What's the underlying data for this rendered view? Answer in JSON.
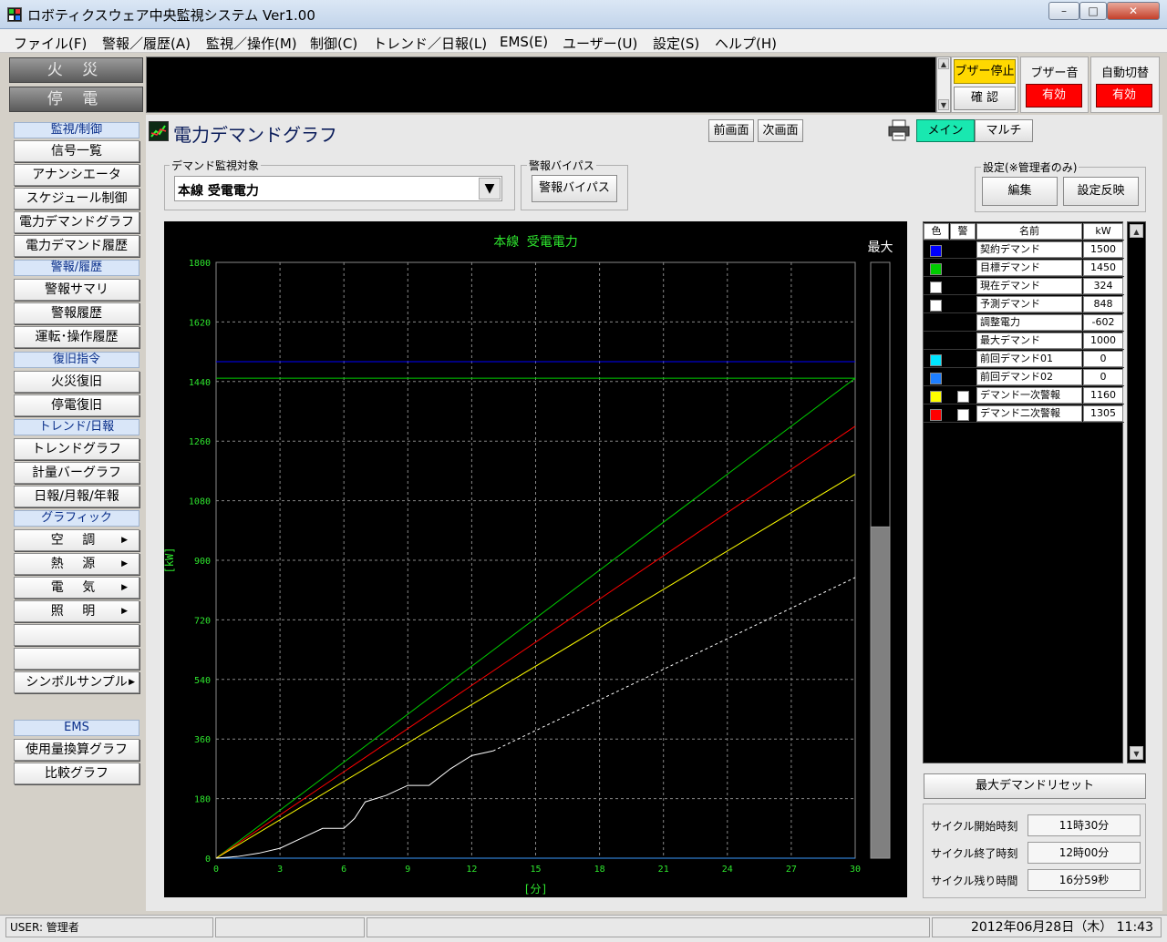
{
  "window": {
    "title": "ロボティクスウェア中央監視システム Ver1.00"
  },
  "menu": [
    "ファイル(F)",
    "警報／履歴(A)",
    "監視／操作(M)",
    "制御(C)",
    "トレンド／日報(L)",
    "EMS(E)",
    "ユーザー(U)",
    "設定(S)",
    "ヘルプ(H)"
  ],
  "alarms": {
    "fire": "火 災",
    "power": "停 電"
  },
  "buzzer": {
    "stop": "ブザー停止",
    "confirm": "確 認",
    "sound_label": "ブザー音",
    "sound_value": "有効",
    "auto_label": "自動切替",
    "auto_value": "有効"
  },
  "sidebar": {
    "monitor_head": "監視/制御",
    "monitor": [
      "信号一覧",
      "アナンシエータ",
      "スケジュール制御",
      "電力デマンドグラフ",
      "電力デマンド履歴"
    ],
    "alarm_head": "警報/履歴",
    "alarm": [
      "警報サマリ",
      "警報履歴",
      "運転･操作履歴"
    ],
    "restore_head": "復旧指令",
    "restore": [
      "火災復旧",
      "停電復旧"
    ],
    "trend_head": "トレンド/日報",
    "trend": [
      "トレンドグラフ",
      "計量バーグラフ",
      "日報/月報/年報"
    ],
    "graphic_head": "グラフィック",
    "graphic": [
      "空 調",
      "熱 源",
      "電 気",
      "照 明",
      "",
      "",
      "シンボルサンプル"
    ],
    "ems_head": "EMS",
    "ems": [
      "使用量換算グラフ",
      "比較グラフ"
    ]
  },
  "page": {
    "title": "電力デマンドグラフ",
    "prev": "前画面",
    "next": "次画面",
    "view_main": "メイン",
    "view_multi": "マルチ",
    "target_legend": "デマンド監視対象",
    "target_value": "本線 受電電力",
    "bypass_legend": "警報バイパス",
    "bypass_btn": "警報バイパス",
    "settings_legend": "設定(※管理者のみ)",
    "edit_btn": "編集",
    "apply_btn": "設定反映"
  },
  "chart_data": {
    "type": "line",
    "title": "本線 受電電力",
    "xlabel": "[分]",
    "ylabel": "[kW]",
    "xlim": [
      0,
      30
    ],
    "ylim": [
      0,
      1800
    ],
    "xticks": [
      0,
      3,
      6,
      9,
      12,
      15,
      18,
      21,
      24,
      27,
      30
    ],
    "yticks": [
      0,
      180,
      360,
      540,
      720,
      900,
      1080,
      1260,
      1440,
      1620,
      1800
    ],
    "grid": true,
    "series": [
      {
        "name": "契約デマンド",
        "color": "#0000ff",
        "style": "solid",
        "x": [
          0,
          30
        ],
        "y": [
          1500,
          1500
        ]
      },
      {
        "name": "目標デマンド",
        "color": "#00cc00",
        "style": "solid",
        "x": [
          0,
          30
        ],
        "y": [
          1450,
          1450
        ]
      },
      {
        "name": "目標デマンド",
        "color": "#00cc00",
        "style": "solid",
        "x": [
          0,
          30
        ],
        "y": [
          0,
          1450
        ]
      },
      {
        "name": "デマンド二次警報",
        "color": "#ff0000",
        "style": "solid",
        "x": [
          0,
          30
        ],
        "y": [
          0,
          1305
        ]
      },
      {
        "name": "デマンド一次警報",
        "color": "#ffff00",
        "style": "solid",
        "x": [
          0,
          30
        ],
        "y": [
          0,
          1160
        ]
      },
      {
        "name": "前回デマンド01",
        "color": "#3a9aff",
        "style": "solid",
        "x": [
          0,
          30
        ],
        "y": [
          0,
          0
        ]
      },
      {
        "name": "現在デマンド",
        "color": "#ffffff",
        "style": "solid",
        "x": [
          0,
          1,
          2,
          3,
          4,
          5,
          6,
          6.5,
          7,
          8,
          9,
          10,
          11,
          12,
          13
        ],
        "y": [
          0,
          5,
          15,
          30,
          60,
          90,
          90,
          120,
          170,
          190,
          220,
          220,
          270,
          310,
          324
        ]
      },
      {
        "name": "予測デマンド",
        "color": "#ffffff",
        "style": "dashed",
        "x": [
          13,
          30
        ],
        "y": [
          324,
          848
        ]
      }
    ],
    "max_label": "最大",
    "max_value_fraction": 0.556
  },
  "legend": {
    "headers": [
      "色",
      "警",
      "名前",
      "kW"
    ],
    "rows": [
      {
        "color": "#0000ff",
        "check": false,
        "name": "契約デマンド",
        "kw": "1500"
      },
      {
        "color": "#00cc00",
        "check": false,
        "name": "目標デマンド",
        "kw": "1450"
      },
      {
        "color": "#ffffff",
        "check": false,
        "name": "現在デマンド",
        "kw": "324"
      },
      {
        "color": "#ffffff",
        "check": false,
        "name": "予測デマンド",
        "kw": "848"
      },
      {
        "color": "",
        "check": false,
        "name": "調整電力",
        "kw": "-602"
      },
      {
        "color": "",
        "check": false,
        "name": "最大デマンド",
        "kw": "1000"
      },
      {
        "color": "#00e5ff",
        "check": false,
        "name": "前回デマンド01",
        "kw": "0"
      },
      {
        "color": "#1e7fff",
        "check": false,
        "name": "前回デマンド02",
        "kw": "0"
      },
      {
        "color": "#ffff00",
        "check": true,
        "name": "デマンド一次警報",
        "kw": "1160"
      },
      {
        "color": "#ff0000",
        "check": true,
        "name": "デマンド二次警報",
        "kw": "1305"
      }
    ]
  },
  "reset_btn": "最大デマンドリセット",
  "cycle": [
    {
      "label": "サイクル開始時刻",
      "value": "11時30分"
    },
    {
      "label": "サイクル終了時刻",
      "value": "12時00分"
    },
    {
      "label": "サイクル残り時間",
      "value": "16分59秒"
    }
  ],
  "status": {
    "user": "USER: 管理者",
    "datetime": "2012年06月28日（木） 11:43"
  }
}
